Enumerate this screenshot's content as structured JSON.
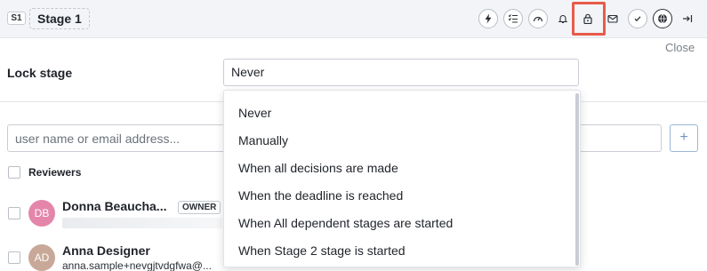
{
  "header": {
    "stage_badge": "S1",
    "stage_title": "Stage 1",
    "toolbar_icons": [
      "lightning-icon",
      "checklist-icon",
      "gauge-icon",
      "bell-icon",
      "lock-icon",
      "mail-icon",
      "check-circle-icon",
      "globe-icon",
      "collapse-right-icon"
    ],
    "highlight_color": "#e85b4a"
  },
  "close_label": "Close",
  "lock": {
    "label": "Lock stage",
    "selected_value": "Never",
    "options": [
      "Never",
      "Manually",
      "When all decisions are made",
      "When the deadline is reached",
      "When All dependent stages are started",
      "When Stage 2 stage is started"
    ]
  },
  "user_search": {
    "placeholder": "user name or email address...",
    "add_label": "+"
  },
  "reviewers": {
    "header_label": "Reviewers",
    "users": [
      {
        "initials": "DB",
        "name": "Donna Beaucha...",
        "badge": "OWNER",
        "email": "",
        "avatar_color": "#e486a9"
      },
      {
        "initials": "AD",
        "name": "Anna Designer",
        "badge": "",
        "email": "anna.sample+nevgjtvdgfwa@...",
        "avatar_color": "#c8a898"
      }
    ]
  }
}
